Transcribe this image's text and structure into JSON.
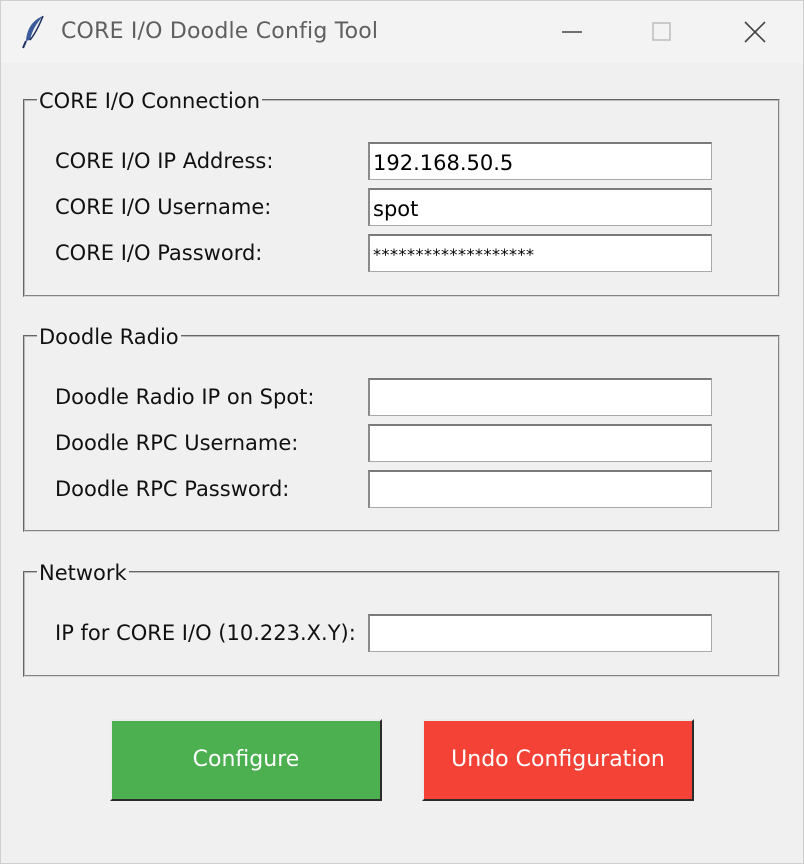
{
  "window": {
    "title": "CORE I/O Doodle Config Tool",
    "app_icon": "feather-icon"
  },
  "groups": {
    "connection": {
      "title": "CORE I/O Connection",
      "fields": [
        {
          "label": "CORE I/O IP Address:",
          "value": "192.168.50.5"
        },
        {
          "label": "CORE I/O Username:",
          "value": "spot"
        },
        {
          "label": "CORE I/O Password:",
          "value": "*******************"
        }
      ]
    },
    "doodle": {
      "title": "Doodle Radio",
      "fields": [
        {
          "label": "Doodle Radio IP on Spot:",
          "value": ""
        },
        {
          "label": "Doodle RPC Username:",
          "value": ""
        },
        {
          "label": "Doodle RPC Password:",
          "value": ""
        }
      ]
    },
    "network": {
      "title": "Network",
      "fields": [
        {
          "label": "IP for CORE I/O (10.223.X.Y):",
          "value": ""
        }
      ]
    }
  },
  "buttons": {
    "configure": "Configure",
    "undo": "Undo Configuration"
  },
  "colors": {
    "configure_bg": "#4caf50",
    "undo_bg": "#f44336",
    "window_bg": "#f0f0f0"
  }
}
